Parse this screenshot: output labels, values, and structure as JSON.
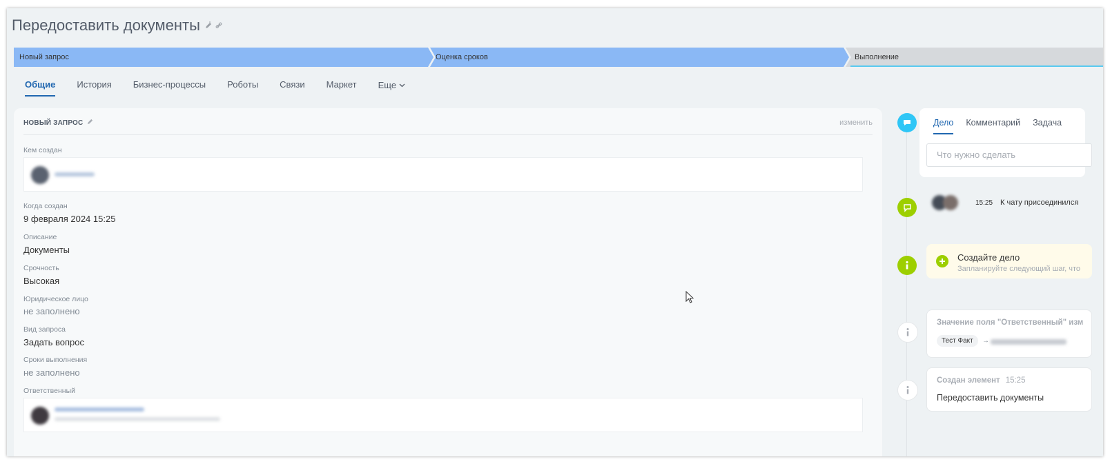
{
  "header": {
    "title": "Передоставить документы",
    "edit_icon": "pencil-icon",
    "link_icon": "link-icon"
  },
  "stages": [
    {
      "label": "Новый запрос",
      "color": "#8ab8f5",
      "state": "done"
    },
    {
      "label": "Оценка сроков",
      "color": "#8ab8f5",
      "state": "current"
    },
    {
      "label": "Выполнение",
      "color": "#d6d9dc",
      "state": "pending"
    }
  ],
  "tabs": [
    {
      "label": "Общие",
      "active": true
    },
    {
      "label": "История"
    },
    {
      "label": "Бизнес-процессы"
    },
    {
      "label": "Роботы"
    },
    {
      "label": "Связи"
    },
    {
      "label": "Маркет"
    },
    {
      "label": "Еще"
    }
  ],
  "section": {
    "title": "НОВЫЙ ЗАПРОС",
    "edit_label": "изменить"
  },
  "fields": {
    "created_by_label": "Кем создан",
    "created_at_label": "Когда создан",
    "created_at_value": "9 февраля 2024 15:25",
    "description_label": "Описание",
    "description_value": "Документы",
    "urgency_label": "Срочность",
    "urgency_value": "Высокая",
    "legal_entity_label": "Юридическое лицо",
    "legal_entity_value": "не заполнено",
    "request_type_label": "Вид запроса",
    "request_type_value": "Задать вопрос",
    "deadlines_label": "Сроки выполнения",
    "deadlines_value": "не заполнено",
    "responsible_label": "Ответственный"
  },
  "activity": {
    "tabs": [
      "Дело",
      "Комментарий",
      "Задача"
    ],
    "input_placeholder": "Что нужно сделать"
  },
  "timeline": {
    "chat_time": "15:25",
    "chat_text": "К чату присоединился",
    "hint_title": "Создайте дело",
    "hint_subtitle": "Запланируйте следующий шаг, что",
    "field_change_title": "Значение поля \"Ответственный\" изм",
    "field_change_from": "Тест Факт",
    "created_title": "Создан элемент",
    "created_time": "15:25",
    "created_body": "Передоставить документы"
  },
  "colors": {
    "accent": "#2067b0",
    "stage_blue": "#8ab8f5",
    "chat_icon": "#2fc6f6",
    "green_icon": "#9dcf00"
  }
}
